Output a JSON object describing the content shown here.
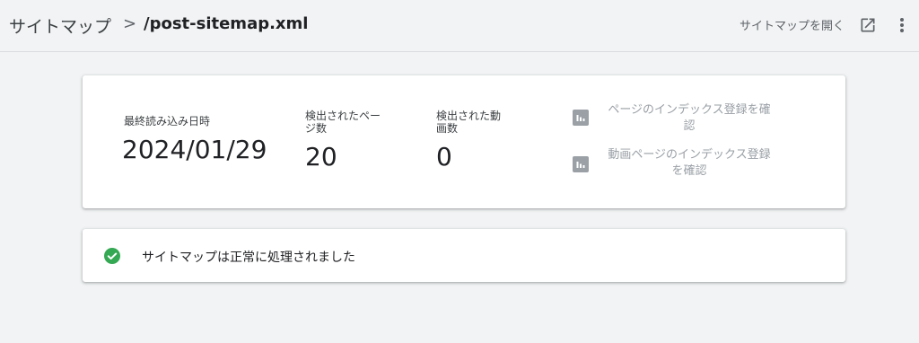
{
  "header": {
    "breadcrumb_root": "サイトマップ",
    "breadcrumb_sep": ">",
    "breadcrumb_current": "/post-sitemap.xml",
    "open_link": "サイトマップを開く",
    "open_icon": "open-in-new-icon",
    "menu_icon": "more-vert-icon"
  },
  "stats": {
    "last_read_label": "最終読み込み日時",
    "last_read_value": "2024/01/29",
    "pages_label_line1": "検出されたペー",
    "pages_label_line2": "ジ数",
    "pages_value": "20",
    "videos_label_line1": "検出された動",
    "videos_label_line2": "画数",
    "videos_value": "0"
  },
  "links": {
    "page_index_line1": "ページのインデックス登録を確",
    "page_index_line2": "認",
    "video_index_line1": "動画ページのインデックス登録",
    "video_index_line2": "を確認",
    "icon": "bar-chart-icon"
  },
  "status": {
    "text": "サイトマップは正常に処理されました",
    "icon": "check-circle-icon",
    "icon_color": "#34a853"
  }
}
